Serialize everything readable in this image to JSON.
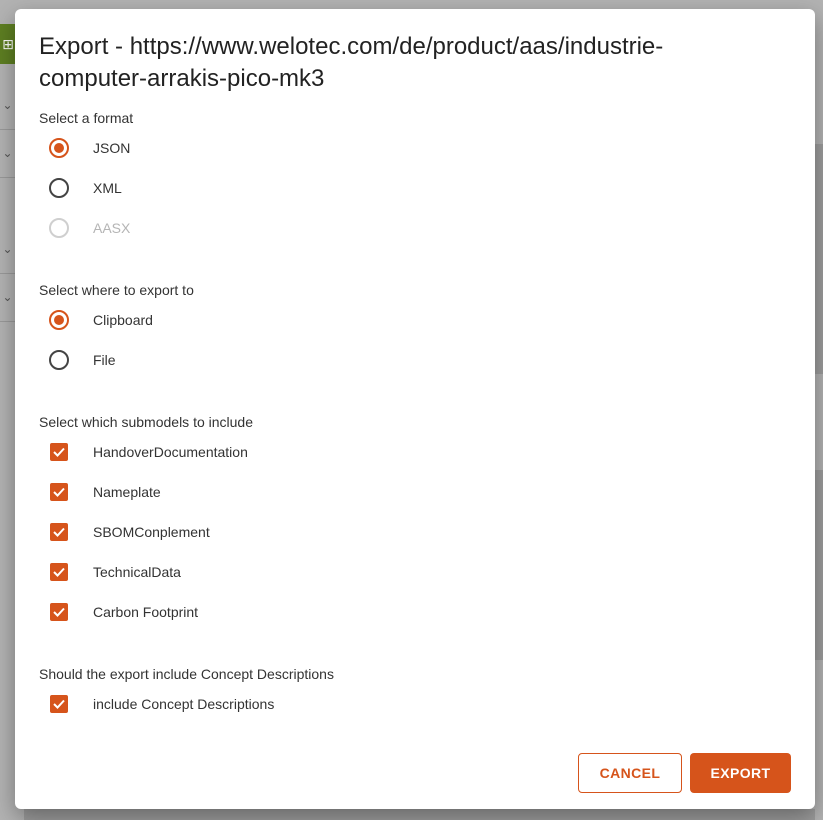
{
  "dialog": {
    "title": "Export - https://www.welotec.com/de/product/aas/industrie-computer-arrakis-pico-mk3"
  },
  "format": {
    "label": "Select a format",
    "options": [
      {
        "label": "JSON",
        "checked": true,
        "disabled": false
      },
      {
        "label": "XML",
        "checked": false,
        "disabled": false
      },
      {
        "label": "AASX",
        "checked": false,
        "disabled": true
      }
    ]
  },
  "destination": {
    "label": "Select where to export to",
    "options": [
      {
        "label": "Clipboard",
        "checked": true
      },
      {
        "label": "File",
        "checked": false
      }
    ]
  },
  "submodels": {
    "label": "Select which submodels to include",
    "items": [
      {
        "label": "HandoverDocumentation",
        "checked": true
      },
      {
        "label": "Nameplate",
        "checked": true
      },
      {
        "label": "SBOMConplement",
        "checked": true
      },
      {
        "label": "TechnicalData",
        "checked": true
      },
      {
        "label": "Carbon Footprint",
        "checked": true
      }
    ]
  },
  "concepts": {
    "label": "Should the export include Concept Descriptions",
    "item": {
      "label": "include Concept Descriptions",
      "checked": true
    }
  },
  "actions": {
    "cancel": "CANCEL",
    "export": "EXPORT"
  },
  "colors": {
    "accent": "#d6541b",
    "background_brand": "#5e7f22"
  },
  "icons": {
    "checkbox": "check-icon",
    "background_rail": "tree-icon",
    "background_rows": "chevron-down-icon"
  }
}
